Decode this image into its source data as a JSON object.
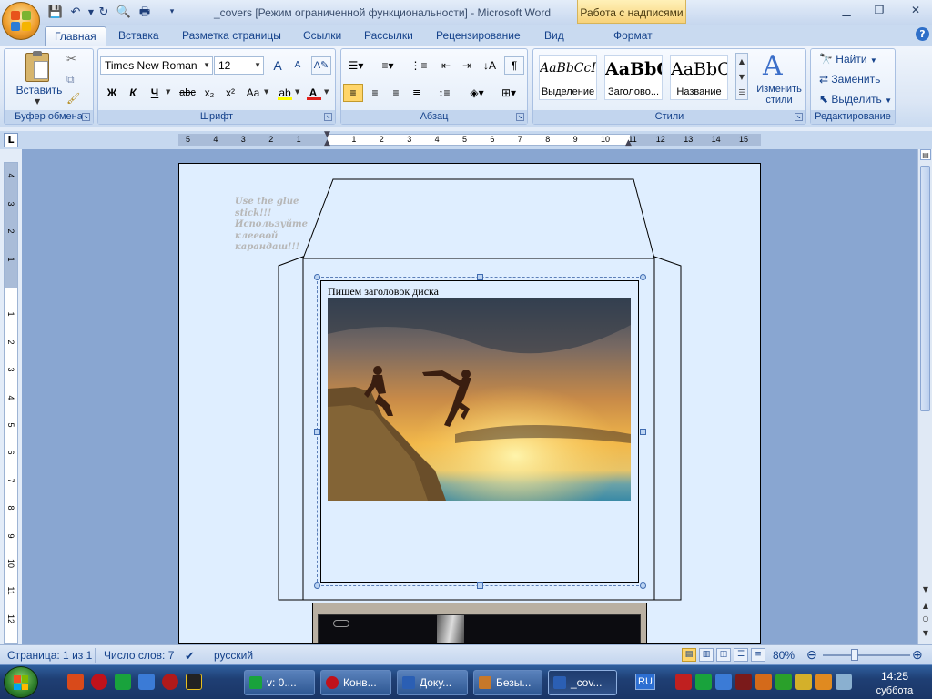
{
  "window": {
    "title": "_covers [Режим ограниченной функциональности] - Microsoft Word",
    "context_tab_title": "Работа с надписями",
    "buttons": {
      "minimize": "▁",
      "maximize": "❐",
      "close": "✕"
    }
  },
  "tabs": [
    {
      "label": "Главная",
      "active": true
    },
    {
      "label": "Вставка"
    },
    {
      "label": "Разметка страницы"
    },
    {
      "label": "Ссылки"
    },
    {
      "label": "Рассылки"
    },
    {
      "label": "Рецензирование"
    },
    {
      "label": "Вид"
    },
    {
      "label": "Формат"
    }
  ],
  "ribbon": {
    "clipboard": {
      "label": "Буфер обмена",
      "paste_label": "Вставить"
    },
    "font": {
      "label": "Шрифт",
      "font_name": "Times New Roman",
      "font_size": "12",
      "bold": "Ж",
      "italic": "К",
      "underline": "Ч",
      "strike": "abc",
      "subscript": "x₂",
      "superscript": "x²",
      "change_case": "Aa",
      "grow": "A",
      "shrink": "A"
    },
    "paragraph": {
      "label": "Абзац",
      "show_marks": "¶"
    },
    "styles": {
      "label": "Стили",
      "items": [
        {
          "sample": "AaBbCcI",
          "name": "Выделение"
        },
        {
          "sample": "AaBbC",
          "name": "Заголово..."
        },
        {
          "sample": "AaBbC",
          "name": "Название"
        }
      ],
      "change_styles": "Изменить стили"
    },
    "editing": {
      "label": "Редактирование",
      "find": "Найти",
      "replace": "Заменить",
      "select": "Выделить"
    }
  },
  "ruler": {
    "horizontal": [
      "5",
      "4",
      "3",
      "2",
      "1",
      "1",
      "2",
      "3",
      "4",
      "5",
      "6",
      "7",
      "8",
      "9",
      "10",
      "11",
      "12",
      "13",
      "14",
      "15"
    ],
    "vertical": [
      "4",
      "3",
      "2",
      "1",
      "1",
      "2",
      "3",
      "4",
      "5",
      "6",
      "7",
      "8",
      "9",
      "10",
      "11",
      "12"
    ],
    "tab_selector": "L"
  },
  "document": {
    "glue_note": [
      "Use the glue stick!!!",
      "Используйте",
      "клеевой",
      "карандаш!!!"
    ],
    "disk_title": "Пишем заголовок диска"
  },
  "status": {
    "page": "Страница: 1 из 1",
    "words": "Число слов: 7",
    "language": "русский",
    "zoom": "80%"
  },
  "taskbar": {
    "items": [
      {
        "label": "v: 0...."
      },
      {
        "label": "Конв..."
      },
      {
        "label": "Доку..."
      },
      {
        "label": "Безы..."
      },
      {
        "label": "_cov...",
        "active": true
      }
    ],
    "lang": "RU",
    "time": "14:25",
    "day": "суббота"
  }
}
